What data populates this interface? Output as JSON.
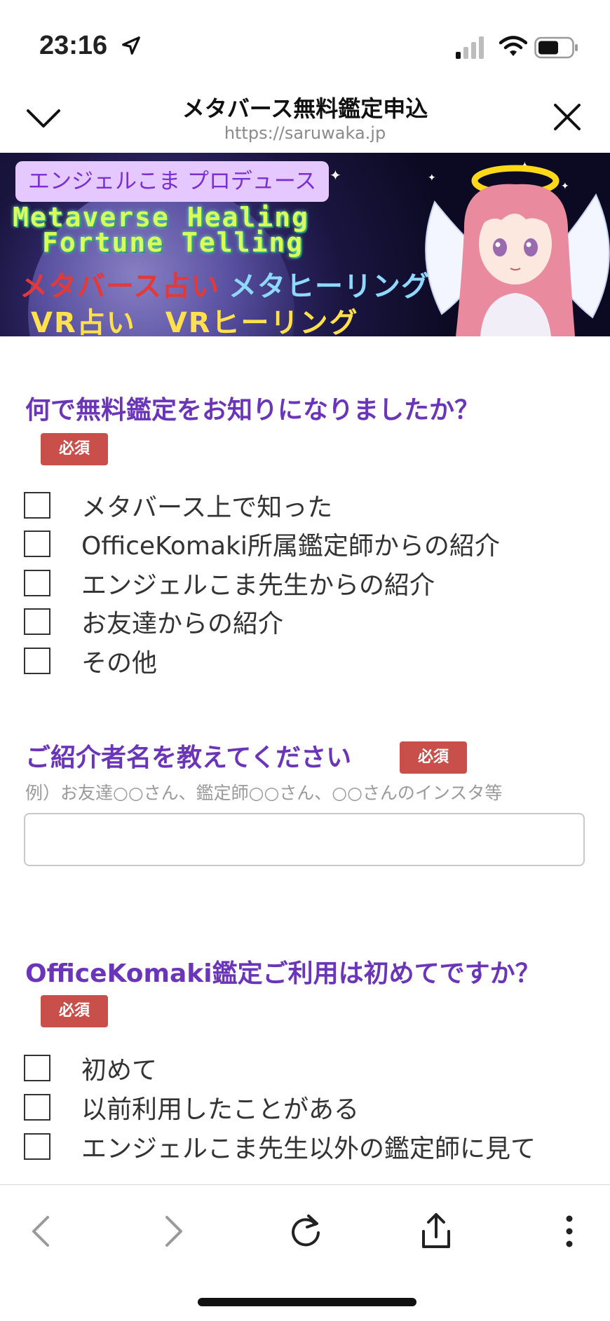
{
  "status_bar": {
    "time": "23:16"
  },
  "header": {
    "title": "メタバース無料鑑定申込",
    "url": "https://saruwaka.jp"
  },
  "banner": {
    "pill": "エンジェルこま プロデュース",
    "english_line1": "Metaverse Healing",
    "english_line2": "Fortune Telling",
    "jp_line1a": "メタバース占い",
    "jp_line1b": "メタヒーリング",
    "jp_line2": "VR占い　VRヒーリング"
  },
  "q1": {
    "title": "何で無料鑑定をお知りになりましたか？",
    "required": "必須",
    "options": [
      "メタバース上で知った",
      "OfficeKomaki所属鑑定師からの紹介",
      "エンジェルこま先生からの紹介",
      "お友達からの紹介",
      "その他"
    ]
  },
  "q2": {
    "title": "ご紹介者名を教えてください",
    "required": "必須",
    "hint": "例）お友達○○さん、鑑定師○○さん、○○さんのインスタ等",
    "value": ""
  },
  "q3": {
    "title": "OfficeKomaki鑑定ご利用は初めてですか？",
    "required": "必須",
    "options": [
      "初めて",
      "以前利用したことがある",
      "エンジェルこま先生以外の鑑定師に見て"
    ]
  },
  "toolbar": {
    "icons": [
      "back-icon",
      "forward-icon",
      "reload-icon",
      "share-icon",
      "more-icon"
    ]
  },
  "colors": {
    "accent": "#6a35b8",
    "required_badge": "#c9504a"
  }
}
